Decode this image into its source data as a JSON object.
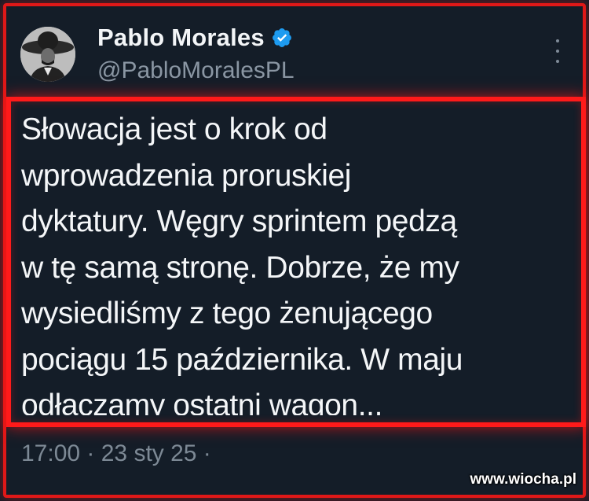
{
  "tweet": {
    "author_name": "Pablo Morales",
    "handle": "@PabloMoralesPL",
    "text": "Słowacja jest o krok od\nwprowadzenia proruskiej\ndyktatury. Węgry sprintem pędzą\nw tę samą stronę. Dobrze, że my\nwysiedliśmy z tego żenującego\npociągu 15 października. W maju\nodłączamy ostatni wagon...",
    "meta": "17:00 · 23 sty 25 ·"
  },
  "watermark": "www.wiocha.pl",
  "colors": {
    "background": "#141d28",
    "highlight": "#ff1a1a",
    "verified": "#1d9bf0"
  },
  "icons": {
    "verified": "verified-badge-icon",
    "more": "more-options-icon"
  }
}
